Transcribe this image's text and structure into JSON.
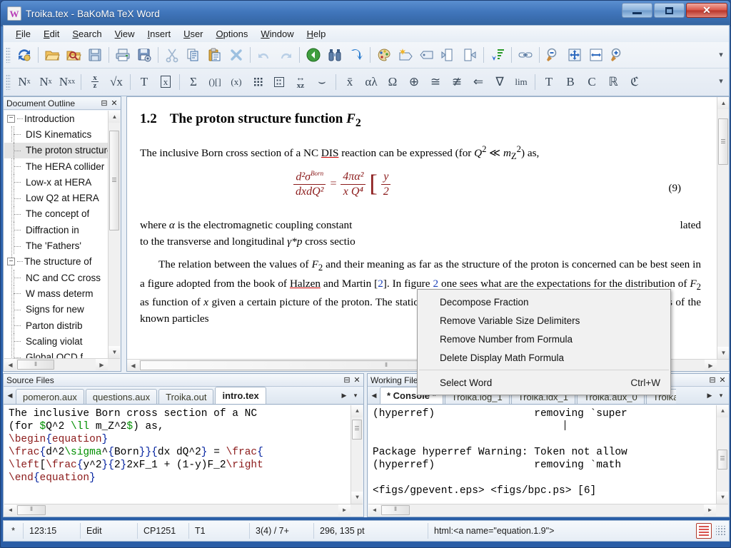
{
  "window": {
    "title": "Troika.tex - BaKoMa TeX Word",
    "app_icon_glyph": "W",
    "controls": {
      "minimize": "Minimize",
      "maximize": "Maximize",
      "close": "✕"
    }
  },
  "menu": [
    {
      "label": "File",
      "accel": "F"
    },
    {
      "label": "Edit",
      "accel": "E"
    },
    {
      "label": "Search",
      "accel": "S"
    },
    {
      "label": "View",
      "accel": "V"
    },
    {
      "label": "Insert",
      "accel": "I"
    },
    {
      "label": "User",
      "accel": "U"
    },
    {
      "label": "Options",
      "accel": "O"
    },
    {
      "label": "Window",
      "accel": "W"
    },
    {
      "label": "Help",
      "accel": "H"
    }
  ],
  "toolbar_main": {
    "overflow_label": "▾",
    "items": [
      {
        "name": "refresh-compile-icon",
        "glyph": "⟳",
        "kind": "img"
      },
      {
        "name": "separator"
      },
      {
        "name": "open-folder-icon",
        "glyph": "📂",
        "kind": "img"
      },
      {
        "name": "open-search-folder-icon",
        "glyph": "🔍",
        "kind": "img"
      },
      {
        "name": "save-icon",
        "glyph": "💾",
        "kind": "img"
      },
      {
        "name": "separator"
      },
      {
        "name": "print-icon",
        "glyph": "🖨",
        "kind": "img"
      },
      {
        "name": "print-setup-icon",
        "glyph": "🖫",
        "kind": "img"
      },
      {
        "name": "separator"
      },
      {
        "name": "cut-icon",
        "glyph": "✂",
        "kind": "img"
      },
      {
        "name": "copy-icon",
        "glyph": "⧉",
        "kind": "img"
      },
      {
        "name": "paste-icon",
        "glyph": "📋",
        "kind": "img"
      },
      {
        "name": "delete-icon",
        "glyph": "✕",
        "kind": "img"
      },
      {
        "name": "separator"
      },
      {
        "name": "undo-icon",
        "glyph": "↺",
        "kind": "img"
      },
      {
        "name": "redo-icon",
        "glyph": "↻",
        "kind": "img"
      },
      {
        "name": "separator"
      },
      {
        "name": "back-icon",
        "glyph": "◀",
        "kind": "img"
      },
      {
        "name": "find-binoculars-icon",
        "glyph": "🔭",
        "kind": "img"
      },
      {
        "name": "goto-icon",
        "glyph": "↷",
        "kind": "img"
      },
      {
        "name": "separator"
      },
      {
        "name": "palette-icon",
        "glyph": "🎨",
        "kind": "img"
      },
      {
        "name": "new-tag-icon",
        "glyph": "🏷",
        "kind": "img"
      },
      {
        "name": "tag-icon",
        "glyph": "🏷",
        "kind": "img"
      },
      {
        "name": "page-left-icon",
        "glyph": "📄",
        "kind": "img"
      },
      {
        "name": "page-right-icon",
        "glyph": "📄",
        "kind": "img"
      },
      {
        "name": "separator"
      },
      {
        "name": "sort-descending-icon",
        "glyph": "⬇",
        "kind": "img"
      },
      {
        "name": "separator"
      },
      {
        "name": "link-icon",
        "glyph": "🔗",
        "kind": "img"
      },
      {
        "name": "separator"
      },
      {
        "name": "zoom-out-icon",
        "glyph": "🔍",
        "kind": "img"
      },
      {
        "name": "fit-page-icon",
        "glyph": "✛",
        "kind": "img"
      },
      {
        "name": "fit-width-icon",
        "glyph": "↔",
        "kind": "img"
      },
      {
        "name": "zoom-in-icon",
        "glyph": "🔍",
        "kind": "img"
      }
    ]
  },
  "toolbar_math": {
    "overflow_label": "▾",
    "items": [
      {
        "name": "superscript-icon",
        "glyph": "N",
        "sup": "x"
      },
      {
        "name": "subscript-icon",
        "glyph": "N",
        "sub": "x"
      },
      {
        "name": "sub-superscript-icon",
        "glyph": "N",
        "sup": "x",
        "sub": "x"
      },
      {
        "name": "separator"
      },
      {
        "name": "fraction-icon",
        "glyph": "x/z"
      },
      {
        "name": "radical-icon",
        "glyph": "√x"
      },
      {
        "name": "separator"
      },
      {
        "name": "text-style-icon",
        "glyph": "T"
      },
      {
        "name": "boxed-formula-icon",
        "glyph": "⊠"
      },
      {
        "name": "separator"
      },
      {
        "name": "sum-operator-icon",
        "glyph": "Σ"
      },
      {
        "name": "delimiters-icon",
        "glyph": "()[]"
      },
      {
        "name": "variable-delimiters-icon",
        "glyph": "(x)"
      },
      {
        "name": "matrix-icon",
        "glyph": "⠿"
      },
      {
        "name": "array-icon",
        "glyph": "⊞"
      },
      {
        "name": "align-xz-icon",
        "glyph": "xz"
      },
      {
        "name": "underbrace-icon",
        "glyph": "⌣"
      },
      {
        "name": "separator"
      },
      {
        "name": "accent-bar-icon",
        "glyph": "x̄"
      },
      {
        "name": "greek-letters-icon",
        "glyph": "αλ"
      },
      {
        "name": "omega-symbol-icon",
        "glyph": "Ω"
      },
      {
        "name": "oplus-symbol-icon",
        "glyph": "⊕"
      },
      {
        "name": "congruent-symbol-icon",
        "glyph": "≅"
      },
      {
        "name": "not-congruent-symbol-icon",
        "glyph": "≇"
      },
      {
        "name": "arrows-symbol-icon",
        "glyph": "⇐"
      },
      {
        "name": "logic-symbol-icon",
        "glyph": "∇"
      },
      {
        "name": "limit-operator-icon",
        "glyph": "lim"
      },
      {
        "name": "separator"
      },
      {
        "name": "roman-font-icon",
        "glyph": "T"
      },
      {
        "name": "bold-font-icon",
        "glyph": "B"
      },
      {
        "name": "calligraphic-font-icon",
        "glyph": "C"
      },
      {
        "name": "blackboard-font-icon",
        "glyph": "ℝ"
      },
      {
        "name": "fraktur-font-icon",
        "glyph": "ℭ"
      }
    ]
  },
  "outline_panel": {
    "caption": "Document Outline",
    "minimize_glyph": "⊟",
    "close_glyph": "✕",
    "items": [
      {
        "label": "Introduction",
        "level": 0,
        "expanded": true,
        "selected": false
      },
      {
        "label": "DIS Kinematics",
        "level": 1,
        "selected": false
      },
      {
        "label": "The proton structure function",
        "level": 1,
        "selected": true
      },
      {
        "label": "The HERA collider",
        "level": 1,
        "selected": false
      },
      {
        "label": "Low-x at HERA",
        "level": 1,
        "selected": false
      },
      {
        "label": "Low Q2 at HERA",
        "level": 1,
        "selected": false
      },
      {
        "label": "The concept of",
        "level": 1,
        "selected": false
      },
      {
        "label": "Diffraction in",
        "level": 1,
        "selected": false
      },
      {
        "label": "The 'Fathers'",
        "level": 1,
        "selected": false
      },
      {
        "label": "The structure of",
        "level": 0,
        "expanded": true,
        "selected": false
      },
      {
        "label": "NC and CC cross",
        "level": 1,
        "selected": false
      },
      {
        "label": "W mass determ",
        "level": 1,
        "selected": false
      },
      {
        "label": "Signs for new",
        "level": 1,
        "selected": false
      },
      {
        "label": "Parton distrib",
        "level": 1,
        "selected": false
      },
      {
        "label": "Scaling violat",
        "level": 1,
        "selected": false
      },
      {
        "label": "Global QCD f",
        "level": 1,
        "selected": false
      }
    ]
  },
  "document": {
    "heading_number": "1.2",
    "heading_text": "The proton structure function",
    "heading_math": "F",
    "heading_math_sub": "2",
    "paragraph1_a": "The inclusive Born cross section of a NC ",
    "paragraph1_link": "DIS",
    "paragraph1_b": " reaction can be expressed (for ",
    "paragraph1_math1": "Q",
    "paragraph1_math1_sup": "2",
    "paragraph1_math_rel": " ≪ ",
    "paragraph1_math2": "m",
    "paragraph1_math2_sub": "Z",
    "paragraph1_math2_sup": "2",
    "paragraph1_c": ") as,",
    "equation": {
      "lhs_num": "d²σ",
      "lhs_num_sup": "Born",
      "lhs_den": "dxdQ²",
      "equals": "=",
      "rhs_num": "4πα²",
      "rhs_den": "x Q⁴",
      "bracket_open": "[",
      "frac2_top": "y",
      "frac2_bot": "2",
      "number": "(9)"
    },
    "paragraph2_a": "where ",
    "paragraph2_alpha": "α",
    "paragraph2_b": " is the electromagnetic coupling constant",
    "paragraph2_tail": "lated",
    "paragraph2_line2": "to the transverse and longitudinal ",
    "paragraph2_line2_math": "γ*p",
    "paragraph2_line2_b": " cross sectio",
    "paragraph3_a": "The relation between the values of ",
    "paragraph3_F": "F",
    "paragraph3_Fsub": "2",
    "paragraph3_b": " and their meaning as far as the structure of the proton is concerned can be best seen in a figure adopted from the book of ",
    "paragraph3_halzen": "Halzen",
    "paragraph3_c": " and Martin [",
    "paragraph3_ref": "2",
    "paragraph3_d": "]. In figure ",
    "paragraph3_figref": "2",
    "paragraph3_e": " one sees what are the expectations for the distribution of ",
    "paragraph3_f": " as function of ",
    "paragraph3_x": "x",
    "paragraph3_g": " given a certain picture of the proton.  The static approach mentioned above could explain most properties of the known particles"
  },
  "context_menu": {
    "items": [
      {
        "label": "Decompose Fraction",
        "shortcut": ""
      },
      {
        "label": "Remove Variable Size Delimiters",
        "shortcut": ""
      },
      {
        "label": "Remove Number from Formula",
        "shortcut": ""
      },
      {
        "label": "Delete Display Math Formula",
        "shortcut": ""
      },
      {
        "separator": true
      },
      {
        "label": "Select Word",
        "shortcut": "Ctrl+W"
      }
    ]
  },
  "source_panel": {
    "caption": "Source Files",
    "minimize_glyph": "⊟",
    "close_glyph": "✕",
    "nav_left": "◀",
    "nav_right": "▶",
    "nav_menu": "▾",
    "tabs": [
      {
        "label": "pomeron.aux",
        "active": false
      },
      {
        "label": "questions.aux",
        "active": false
      },
      {
        "label": "Troika.out",
        "active": false
      },
      {
        "label": "intro.tex",
        "active": true
      }
    ],
    "code_lines": [
      {
        "segments": [
          {
            "t": "The inclusive Born cross section of a NC",
            "c": "c-black"
          }
        ]
      },
      {
        "segments": [
          {
            "t": "(for ",
            "c": "c-black"
          },
          {
            "t": "$",
            "c": "c-green"
          },
          {
            "t": "Q^2 ",
            "c": "c-black"
          },
          {
            "t": "\\ll",
            "c": "c-green"
          },
          {
            "t": " m_Z^2",
            "c": "c-black"
          },
          {
            "t": "$",
            "c": "c-green"
          },
          {
            "t": ") as,",
            "c": "c-black"
          }
        ]
      },
      {
        "segments": [
          {
            "t": "\\begin",
            "c": "c-dred"
          },
          {
            "t": "{",
            "c": "c-blue"
          },
          {
            "t": "equation",
            "c": "c-dred"
          },
          {
            "t": "}",
            "c": "c-blue"
          }
        ]
      },
      {
        "segments": [
          {
            "t": "\\frac",
            "c": "c-dred"
          },
          {
            "t": "{",
            "c": "c-blue"
          },
          {
            "t": "d^2",
            "c": "c-black"
          },
          {
            "t": "\\sigma",
            "c": "c-green"
          },
          {
            "t": "^",
            "c": "c-black"
          },
          {
            "t": "{",
            "c": "c-blue"
          },
          {
            "t": "Born",
            "c": "c-black"
          },
          {
            "t": "}}{",
            "c": "c-blue"
          },
          {
            "t": "dx dQ^2",
            "c": "c-black"
          },
          {
            "t": "}",
            "c": "c-blue"
          },
          {
            "t": " = ",
            "c": "c-black"
          },
          {
            "t": "\\frac",
            "c": "c-dred"
          },
          {
            "t": "{",
            "c": "c-blue"
          }
        ]
      },
      {
        "segments": [
          {
            "t": "\\left",
            "c": "c-dred"
          },
          {
            "t": "[",
            "c": "c-black"
          },
          {
            "t": "\\frac",
            "c": "c-dred"
          },
          {
            "t": "{",
            "c": "c-blue"
          },
          {
            "t": "y^2",
            "c": "c-black"
          },
          {
            "t": "}{",
            "c": "c-blue"
          },
          {
            "t": "2",
            "c": "c-black"
          },
          {
            "t": "}",
            "c": "c-blue"
          },
          {
            "t": "2xF_1 + (1-y)F_2",
            "c": "c-black"
          },
          {
            "t": "\\right",
            "c": "c-dred"
          }
        ]
      },
      {
        "segments": [
          {
            "t": "\\end",
            "c": "c-dred"
          },
          {
            "t": "{",
            "c": "c-blue"
          },
          {
            "t": "equation",
            "c": "c-dred"
          },
          {
            "t": "}",
            "c": "c-blue"
          }
        ]
      }
    ]
  },
  "working_panel": {
    "caption": "Working Files",
    "minimize_glyph": "⊟",
    "close_glyph": "✕",
    "nav_left": "◀",
    "nav_right": "▶",
    "nav_menu": "▾",
    "tabs": [
      {
        "label": "* Console *",
        "active": true
      },
      {
        "label": "Troika.log_1",
        "active": false
      },
      {
        "label": "Troika.idx_1",
        "active": false
      },
      {
        "label": "Troika.aux_0",
        "active": false
      },
      {
        "label": "Troika",
        "active": false
      }
    ],
    "console_lines": [
      "(hyperref)                removing `super",
      "",
      "",
      "Package hyperref Warning: Token not allow",
      "(hyperref)                removing `math",
      "",
      "<figs/gpevent.eps> <figs/bpc.ps> [6]"
    ]
  },
  "status_bar": {
    "modified": "*",
    "position": "123:15",
    "mode": "Edit",
    "encoding": "CP1251",
    "font_encoding": "T1",
    "pages": "3(4) / 7+",
    "measure": "296, 135 pt",
    "anchor": "html:<a name=\"equation.1.9\">"
  },
  "colors": {
    "title_bar": "#3f74ba",
    "accent": "#2a5da6",
    "equation_red": "#8b1a1a",
    "link_blue": "#1a3fb8",
    "close_red": "#c0392b",
    "selection_gray": "#e3e3e3"
  }
}
